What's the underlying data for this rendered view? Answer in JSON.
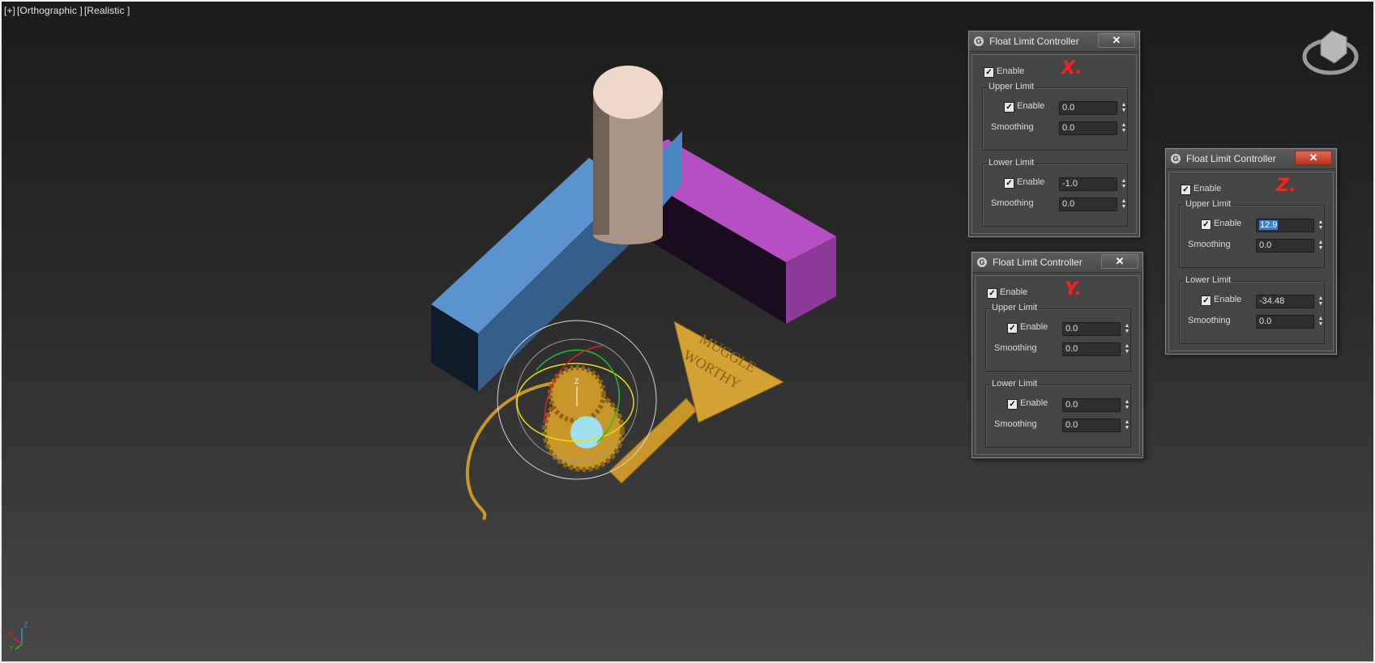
{
  "viewport": {
    "label_plus": "[+]",
    "label_view": "[Orthographic ]",
    "label_shading": "[Realistic ]",
    "key_text_line1": "MUGGLE",
    "key_text_line2": "WORTHY",
    "gizmo_axis_label": "Z"
  },
  "dialogs": [
    {
      "title": "Float Limit Controller",
      "annotation": "X.",
      "enable_label": "Enable",
      "upper_group": "Upper Limit",
      "upper_enable_label": "Enable",
      "upper_value": "0.0",
      "upper_smoothing_label": "Smoothing",
      "upper_smoothing": "0.0",
      "lower_group": "Lower Limit",
      "lower_enable_label": "Enable",
      "lower_value": "-1.0",
      "lower_smoothing_label": "Smoothing",
      "lower_smoothing": "0.0"
    },
    {
      "title": "Float Limit Controller",
      "annotation": "Y.",
      "enable_label": "Enable",
      "upper_group": "Upper Limit",
      "upper_enable_label": "Enable",
      "upper_value": "0.0",
      "upper_smoothing_label": "Smoothing",
      "upper_smoothing": "0.0",
      "lower_group": "Lower Limit",
      "lower_enable_label": "Enable",
      "lower_value": "0.0",
      "lower_smoothing_label": "Smoothing",
      "lower_smoothing": "0.0"
    },
    {
      "title": "Float Limit Controller",
      "annotation": "Z.",
      "enable_label": "Enable",
      "upper_group": "Upper Limit",
      "upper_enable_label": "Enable",
      "upper_value": "12.9",
      "upper_smoothing_label": "Smoothing",
      "upper_smoothing": "0.0",
      "lower_group": "Lower Limit",
      "lower_enable_label": "Enable",
      "lower_value": "-34.48",
      "lower_smoothing_label": "Smoothing",
      "lower_smoothing": "0.0"
    }
  ],
  "axis_tripod": {
    "x": "X",
    "y": "Y",
    "z": "Z"
  },
  "colors": {
    "box_blue": "#5b93d0",
    "box_purple": "#b64fc4",
    "cylinder": "#a89585",
    "key_gold": "#c9962a",
    "annotation_red": "#ff1f1f"
  }
}
